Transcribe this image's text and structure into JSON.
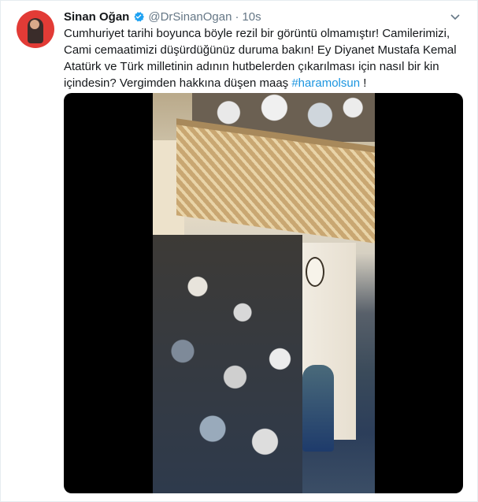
{
  "tweet": {
    "name": "Sinan Oğan",
    "handle": "@DrSinanOgan",
    "separator": "·",
    "time": "10s",
    "text_main": "Cumhuriyet tarihi boyunca böyle rezil bir görüntü olmamıştır! Camilerimizi, Cami cemaatimizi düşürdüğünüz duruma bakın! Ey Diyanet Mustafa Kemal Atatürk ve Türk milletinin adının hutbelerden çıkarılması için nasıl bir kin içindesin? Vergimden hakkına düşen maaş ",
    "hashtag": "#haramolsun",
    "text_end": " !",
    "verified_icon": "verified-badge-icon",
    "menu_icon": "chevron-down-icon",
    "colors": {
      "accent": "#1b95e0",
      "text": "#14171a",
      "muted": "#657786"
    }
  },
  "media": {
    "type": "video"
  }
}
